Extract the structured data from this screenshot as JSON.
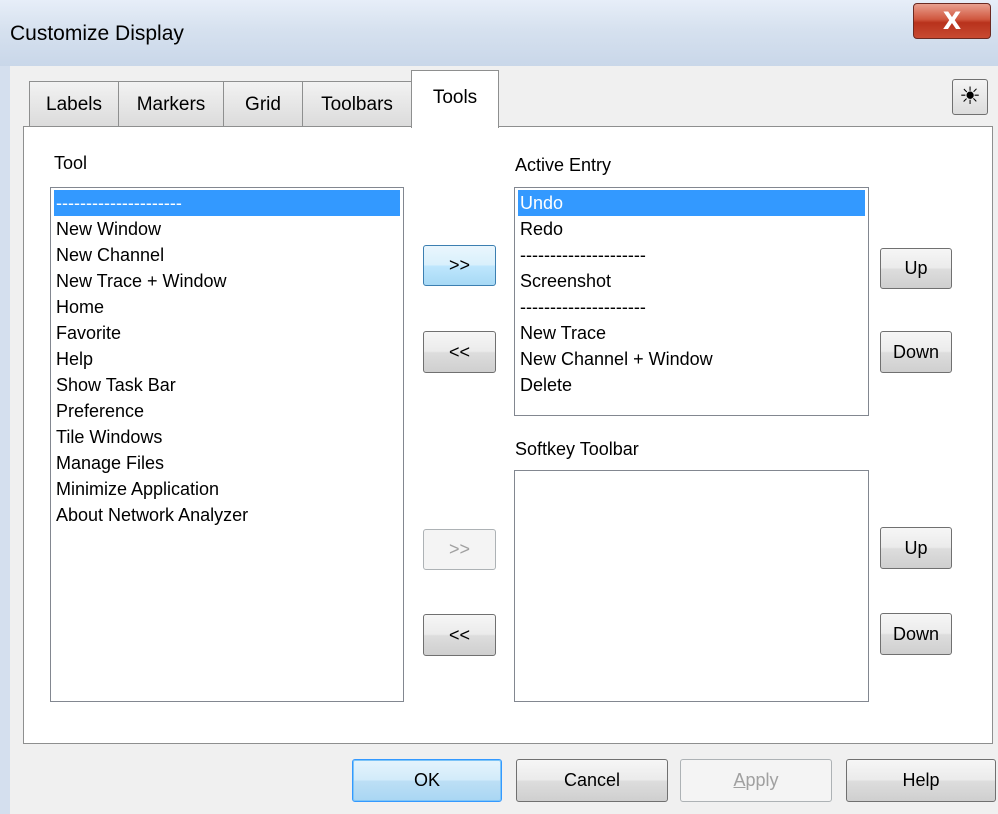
{
  "window": {
    "title": "Customize Display",
    "close_glyph": "X"
  },
  "tabs": [
    {
      "label": "Labels"
    },
    {
      "label": "Markers"
    },
    {
      "label": "Grid"
    },
    {
      "label": "Toolbars"
    },
    {
      "label": "Tools"
    }
  ],
  "active_tab": "Tools",
  "sun_glyph": "☀",
  "tool": {
    "label": "Tool",
    "items": [
      {
        "label": "---------------------",
        "selected": true
      },
      {
        "label": "New Window"
      },
      {
        "label": "New Channel"
      },
      {
        "label": "New Trace + Window"
      },
      {
        "label": "Home"
      },
      {
        "label": "Favorite"
      },
      {
        "label": "Help"
      },
      {
        "label": "Show Task Bar"
      },
      {
        "label": "Preference"
      },
      {
        "label": "Tile Windows"
      },
      {
        "label": "Manage Files"
      },
      {
        "label": "Minimize Application"
      },
      {
        "label": "About Network Analyzer"
      }
    ]
  },
  "active_entry": {
    "label": "Active Entry",
    "items": [
      {
        "label": "Undo",
        "selected": true
      },
      {
        "label": "Redo"
      },
      {
        "label": "---------------------"
      },
      {
        "label": "Screenshot"
      },
      {
        "label": "---------------------"
      },
      {
        "label": "New Trace"
      },
      {
        "label": "New Channel + Window"
      },
      {
        "label": "Delete"
      }
    ],
    "add_button": ">>",
    "remove_button": "<<",
    "up_button": "Up",
    "down_button": "Down"
  },
  "softkey_toolbar": {
    "label": "Softkey Toolbar",
    "items": [],
    "add_button": ">>",
    "remove_button": "<<",
    "up_button": "Up",
    "down_button": "Down"
  },
  "footer": {
    "ok": "OK",
    "cancel": "Cancel",
    "apply_accel": "A",
    "apply_rest": "pply",
    "help": "Help"
  },
  "colors": {
    "selection": "#3399ff",
    "accent_border": "#3c7fb1"
  }
}
